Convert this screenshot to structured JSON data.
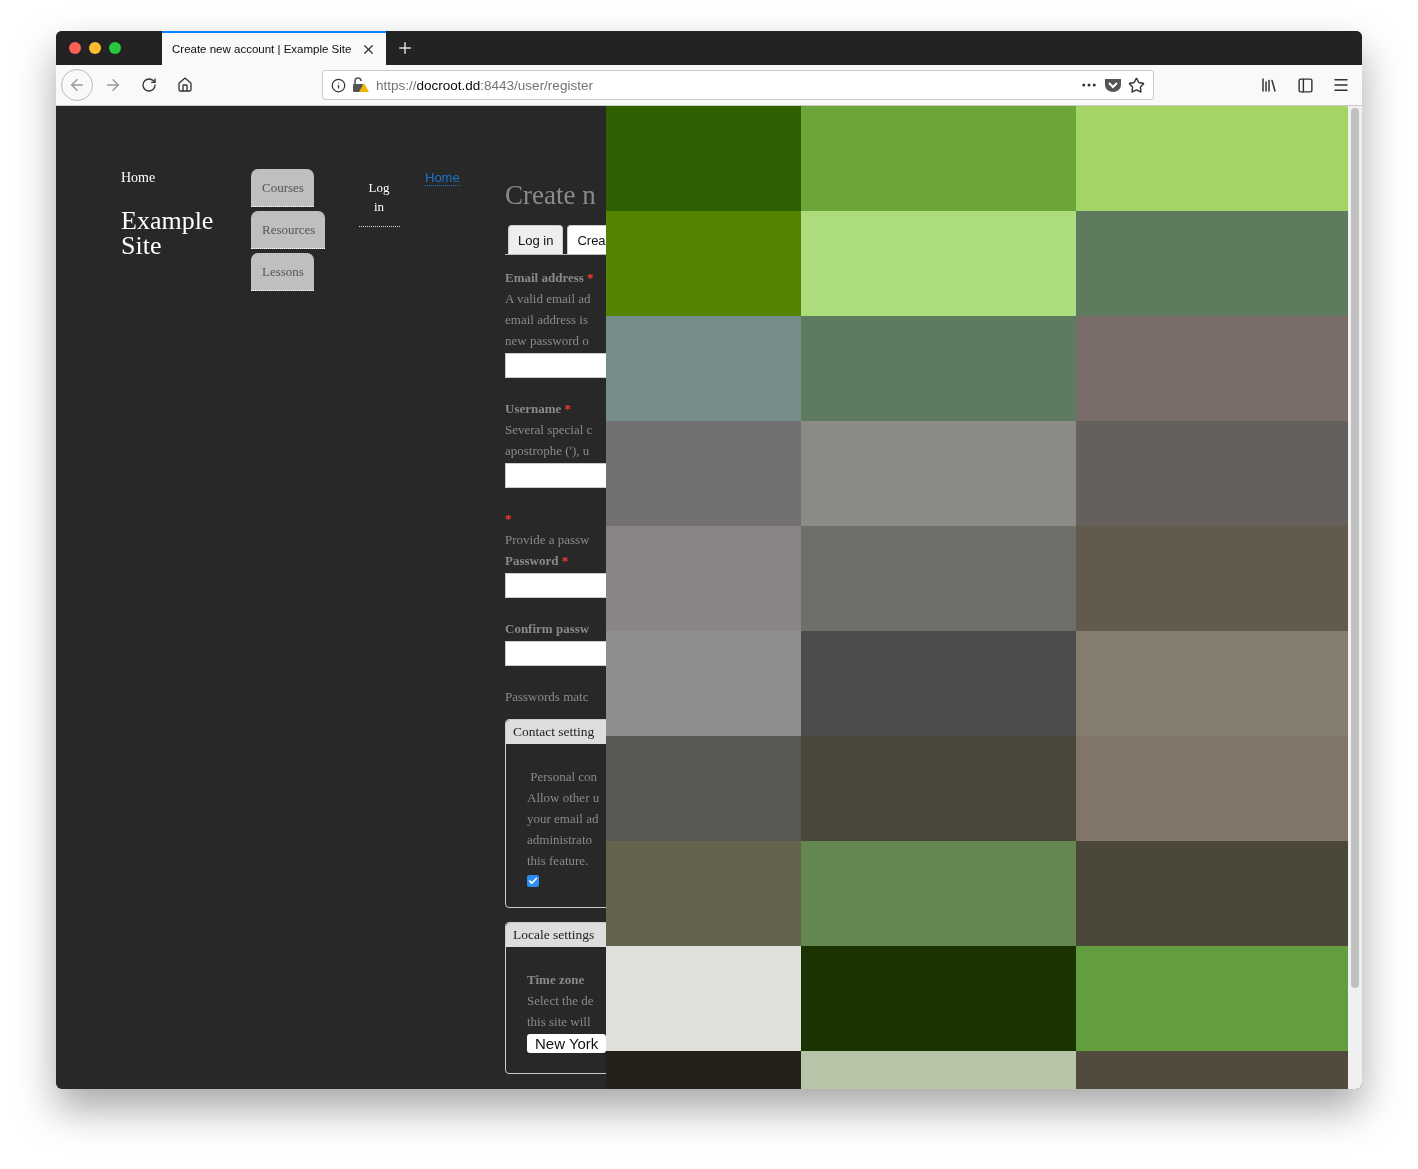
{
  "browser": {
    "tab": {
      "title": "Create new account | Example Site",
      "selected": true
    },
    "url": {
      "scheme": "https://",
      "host": "docroot.dd",
      "rest": ":8443/user/register"
    }
  },
  "site": {
    "home_link": "Home",
    "site_name": "Example Site"
  },
  "nav": [
    {
      "label": "Courses"
    },
    {
      "label": "Resources"
    },
    {
      "label": "Lessons"
    }
  ],
  "account_menu": {
    "label": "Log in"
  },
  "breadcrumb": {
    "label": "Home"
  },
  "page_title": "Create n",
  "required_mark": "*",
  "tabs": [
    {
      "label": "Log in",
      "selected": false
    },
    {
      "label": "Crea",
      "selected": true
    }
  ],
  "form": [
    {
      "kind": "label",
      "text": "Email address",
      "required": true
    },
    {
      "kind": "help",
      "lines": [
        "A valid email ad",
        "email address is",
        "new password o"
      ]
    },
    {
      "kind": "input"
    },
    {
      "kind": "label",
      "text": "Username",
      "required": true
    },
    {
      "kind": "help",
      "lines": [
        "Several special c",
        "apostrophe ('), u"
      ]
    },
    {
      "kind": "input"
    },
    {
      "kind": "label",
      "required": true
    },
    {
      "kind": "help",
      "lines": [
        "Provide a passw"
      ]
    },
    {
      "kind": "label",
      "text": "Password",
      "required": true
    },
    {
      "kind": "input"
    },
    {
      "kind": "label",
      "text": "Confirm passw",
      "required": false
    },
    {
      "kind": "input"
    },
    {
      "kind": "help",
      "lines": [
        "Passwords matc"
      ]
    }
  ],
  "fieldsets": [
    {
      "legend": "Contact setting",
      "items": [
        {
          "kind": "help",
          "lines": [
            " Personal con",
            "Allow other u",
            "your email ad",
            "administrato",
            "this feature."
          ]
        },
        {
          "kind": "checkbox",
          "checked": true
        }
      ]
    },
    {
      "legend": "Locale settings",
      "items": [
        {
          "kind": "label",
          "text": "Time zone",
          "required": false
        },
        {
          "kind": "help",
          "lines": [
            "Select the de",
            "this site will"
          ]
        },
        {
          "kind": "select",
          "value": "New York"
        }
      ]
    }
  ]
}
